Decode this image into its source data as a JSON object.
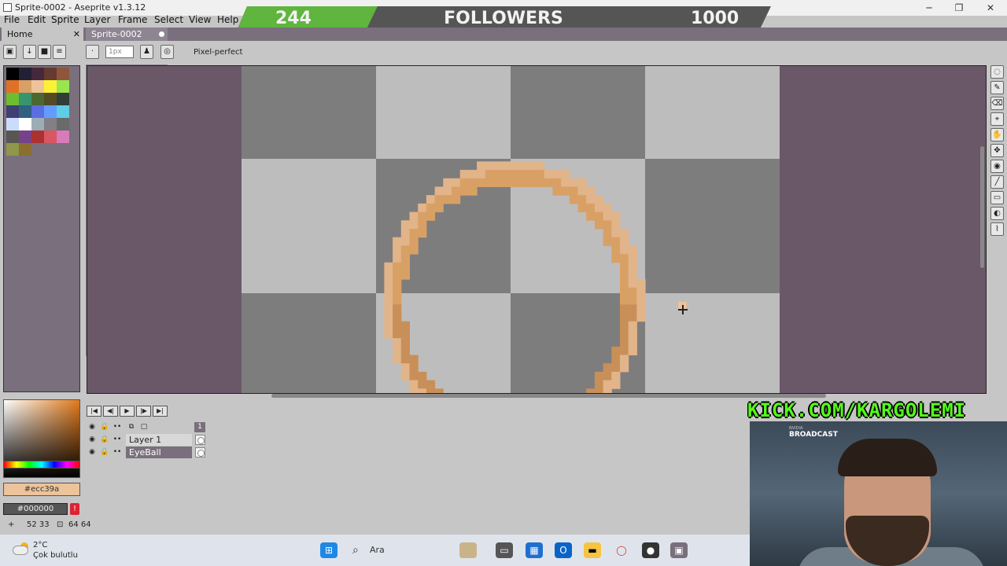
{
  "window": {
    "title": "Sprite-0002 - Aseprite v1.3.12",
    "minimize": "─",
    "maximize": "❐",
    "close": "✕"
  },
  "menu": [
    "File",
    "Edit",
    "Sprite",
    "Layer",
    "Frame",
    "Select",
    "View",
    "Help"
  ],
  "followers": {
    "current": "244",
    "label": "FOLLOWERS",
    "goal": "1000",
    "progress": 0.244,
    "fill_color": "#5fb53e"
  },
  "tabs": {
    "home": "Home",
    "home_close": "✕",
    "sprite": "Sprite-0002"
  },
  "context_bar": {
    "brush_size": "1px",
    "pixel_perfect": "Pixel-perfect"
  },
  "palette": {
    "colors": [
      "#000000",
      "#222034",
      "#45283c",
      "#663931",
      "#8f563b",
      "#df7126",
      "#d9a066",
      "#eec39a",
      "#fbf236",
      "#99e550",
      "#6abe30",
      "#37946e",
      "#4b692f",
      "#524b24",
      "#323c39",
      "#3f3f74",
      "#306082",
      "#5b6ee1",
      "#639bff",
      "#5fcde4",
      "#cbdbfc",
      "#ffffff",
      "#9badb7",
      "#847e87",
      "#696a6a",
      "#595652",
      "#76428a",
      "#ac3232",
      "#d95763",
      "#d77bba",
      "#8f974a",
      "#8a6f30"
    ]
  },
  "colors": {
    "foreground": "#ecc39a",
    "background": "#000000",
    "warning": "!",
    "accent_dark": "#7a6f7c",
    "workspace": "#6a5868",
    "checker_dark": "#7d7d7d",
    "checker_light": "#bdbdbd"
  },
  "timeline": {
    "frame": "1",
    "layers": [
      {
        "name": "Layer 1",
        "selected": false
      },
      {
        "name": "EyeBall",
        "selected": true
      }
    ]
  },
  "status": {
    "position": "52 33",
    "size": "64 64"
  },
  "stream": {
    "kick": "KICK.COM/KARGOLEMI",
    "broadcast": "BROADCAST",
    "nvidia": "NVIDIA"
  },
  "taskbar": {
    "temperature": "2°C",
    "condition": "Çok bulutlu",
    "search": "Ara"
  },
  "icons": {
    "toolbar": [
      "lock",
      "download",
      "save",
      "menu"
    ],
    "tools": [
      "marquee",
      "pencil",
      "eraser",
      "eyedropper",
      "hand",
      "move",
      "fill",
      "line",
      "rectangle",
      "blur",
      "contour"
    ]
  }
}
